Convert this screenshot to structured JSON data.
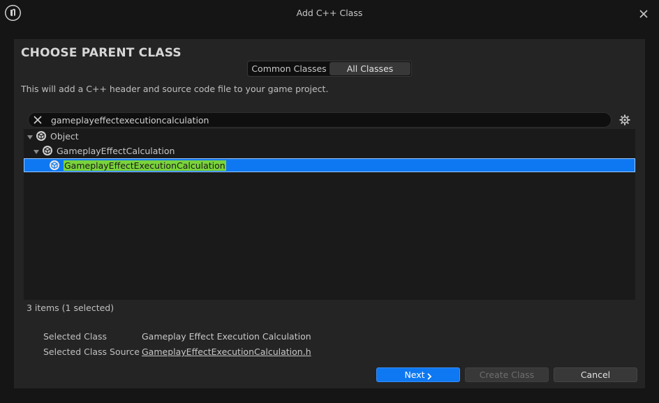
{
  "window": {
    "title": "Add C++ Class"
  },
  "panel": {
    "heading": "CHOOSE PARENT CLASS",
    "tabs": [
      {
        "label": "Common Classes",
        "active": false
      },
      {
        "label": "All Classes",
        "active": true
      }
    ],
    "description": "This will add a C++ header and source code file to your game project."
  },
  "search": {
    "value": "gameplayeffectexecutioncalculation"
  },
  "tree": {
    "items": [
      {
        "label": "Object",
        "expanded": true,
        "selected": false
      },
      {
        "label": "GameplayEffectCalculation",
        "expanded": true,
        "selected": false
      },
      {
        "label": "GameplayEffectExecutionCalculation",
        "expanded": false,
        "selected": true
      }
    ],
    "count_text": "3 items (1 selected)"
  },
  "info": {
    "selected_class_label": "Selected Class",
    "selected_class_value": "Gameplay Effect Execution Calculation",
    "source_label": "Selected Class Source",
    "source_value": "GameplayEffectExecutionCalculation.h"
  },
  "buttons": {
    "next": "Next",
    "create": "Create Class",
    "cancel": "Cancel"
  },
  "colors": {
    "accent": "#0e78f2",
    "highlight": "#7ad33b",
    "panel": "#242424",
    "background": "#151515"
  }
}
